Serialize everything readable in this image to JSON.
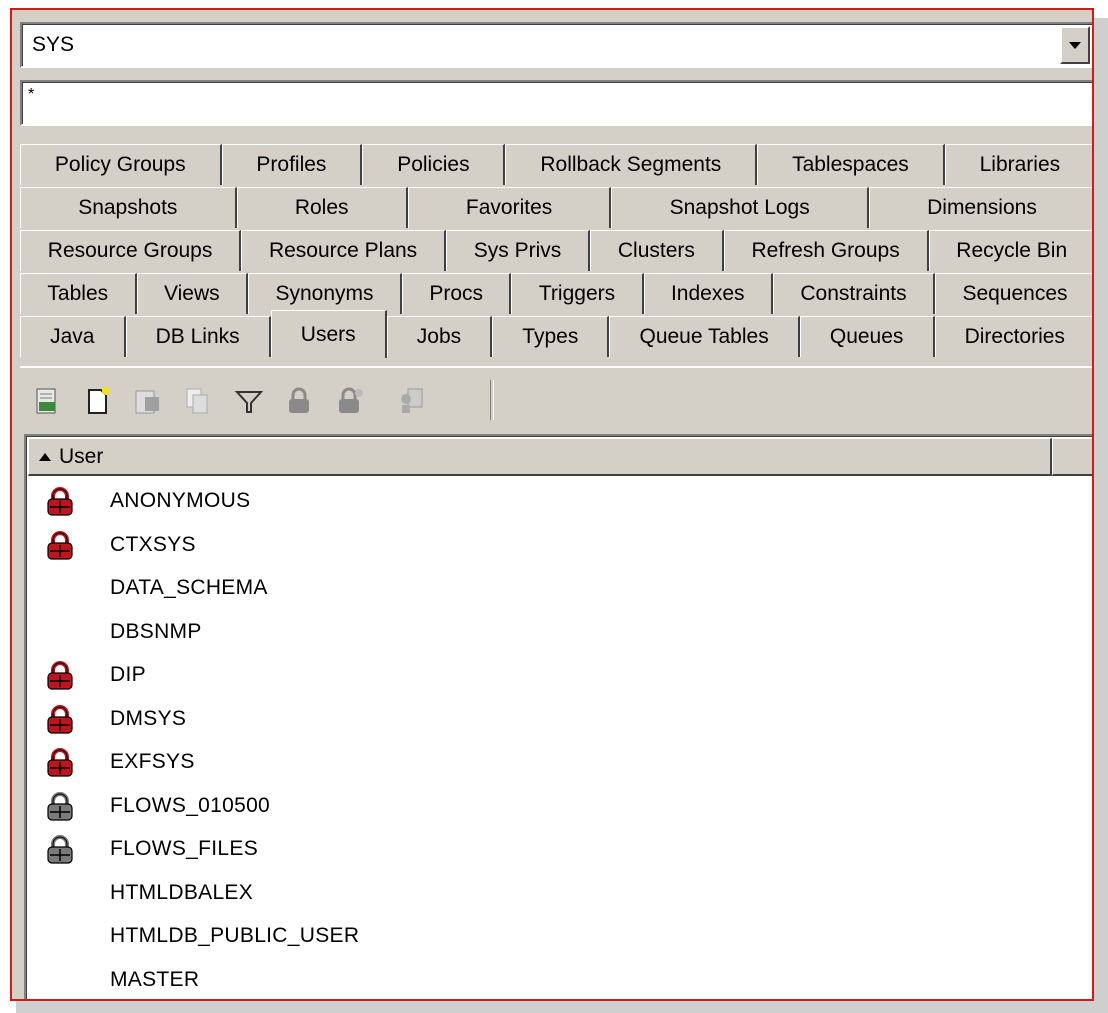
{
  "schema_selector": {
    "value": "SYS"
  },
  "filter_field": {
    "value": "*"
  },
  "tabs": {
    "rows": [
      [
        "Policy Groups",
        "Profiles",
        "Policies",
        "Rollback Segments",
        "Tablespaces",
        "Libraries"
      ],
      [
        "Snapshots",
        "Roles",
        "Favorites",
        "Snapshot Logs",
        "Dimensions"
      ],
      [
        "Resource Groups",
        "Resource Plans",
        "Sys Privs",
        "Clusters",
        "Refresh Groups",
        "Recycle Bin"
      ],
      [
        "Tables",
        "Views",
        "Synonyms",
        "Procs",
        "Triggers",
        "Indexes",
        "Constraints",
        "Sequences"
      ],
      [
        "Java",
        "DB Links",
        "Users",
        "Jobs",
        "Types",
        "Queue Tables",
        "Queues",
        "Directories"
      ]
    ],
    "active": "Users"
  },
  "toolbar": {
    "buttons": [
      {
        "icon": "refresh-icon",
        "enabled": true
      },
      {
        "icon": "new-icon",
        "enabled": true
      },
      {
        "icon": "edit-icon",
        "enabled": false
      },
      {
        "icon": "copy-icon",
        "enabled": false
      },
      {
        "icon": "filter-icon",
        "enabled": true
      },
      {
        "icon": "lock-icon",
        "enabled": false
      },
      {
        "icon": "unlock-icon",
        "enabled": false
      },
      {
        "icon": "report-icon",
        "enabled": false
      }
    ]
  },
  "grid": {
    "column": "User",
    "sort": "ascending",
    "rows": [
      {
        "name": "ANONYMOUS",
        "lock": "red"
      },
      {
        "name": "CTXSYS",
        "lock": "red"
      },
      {
        "name": "DATA_SCHEMA",
        "lock": "none"
      },
      {
        "name": "DBSNMP",
        "lock": "none"
      },
      {
        "name": "DIP",
        "lock": "red"
      },
      {
        "name": "DMSYS",
        "lock": "red"
      },
      {
        "name": "EXFSYS",
        "lock": "red"
      },
      {
        "name": "FLOWS_010500",
        "lock": "gray"
      },
      {
        "name": "FLOWS_FILES",
        "lock": "gray"
      },
      {
        "name": "HTMLDBALEX",
        "lock": "none"
      },
      {
        "name": "HTMLDB_PUBLIC_USER",
        "lock": "none"
      },
      {
        "name": "MASTER",
        "lock": "none"
      }
    ]
  },
  "colors": {
    "frame": "#d11a1a",
    "face": "#d4d0c8",
    "lock_red": "#c0141c",
    "lock_gray": "#7a7a7a"
  }
}
